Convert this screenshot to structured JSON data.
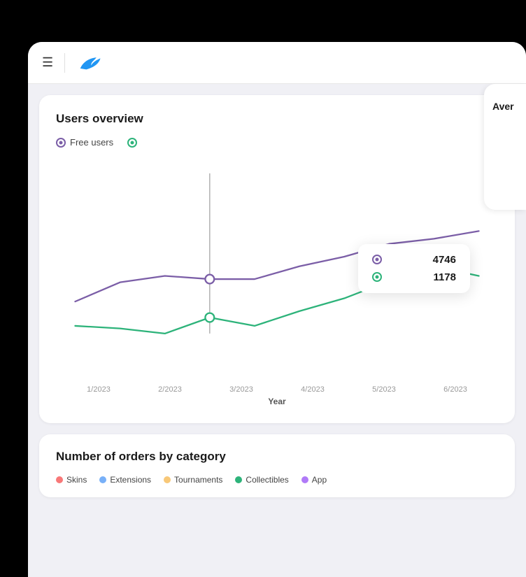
{
  "navbar": {
    "hamburger_label": "☰",
    "logo_alt": "App logo"
  },
  "users_overview": {
    "title": "Users overview",
    "legend": {
      "free_users_label": "Free users",
      "paid_users_label": ""
    },
    "x_axis": {
      "labels": [
        "1/2023",
        "2/2023",
        "3/2023",
        "4/2023",
        "5/2023",
        "6/2023"
      ],
      "title": "Year"
    },
    "tooltip": {
      "purple_value": "4746",
      "green_value": "1178"
    },
    "purple_line_points": "30,220 100,185 170,175 240,180 310,180 380,160 450,140 520,120 590,110 660,100",
    "green_line_points": "30,270 100,275 170,280 240,310 310,240 380,230 450,210 520,180 590,160 660,175"
  },
  "orders_by_category": {
    "title": "Number of orders by category",
    "legend_items": [
      {
        "label": "Skins",
        "color": "#f87878"
      },
      {
        "label": "Extensions",
        "color": "#78b0f8"
      },
      {
        "label": "Tournaments",
        "color": "#f8c878"
      },
      {
        "label": "Collectibles",
        "color": "#2db37a"
      },
      {
        "label": "App",
        "color": "#b07af8"
      }
    ]
  },
  "right_card": {
    "title_partial": "Aver"
  }
}
